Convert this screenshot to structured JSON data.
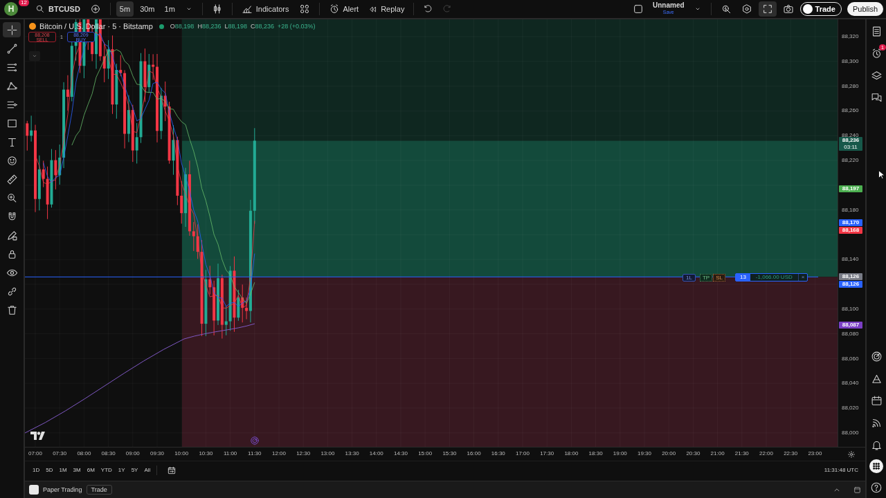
{
  "top_bar": {
    "avatar": {
      "letter": "H",
      "badge": "12"
    },
    "symbol": "BTCUSD",
    "intervals": [
      {
        "label": "5m",
        "selected": true
      },
      {
        "label": "30m",
        "selected": false
      },
      {
        "label": "1m",
        "selected": false
      }
    ],
    "indicators_label": "Indicators",
    "alert_label": "Alert",
    "replay_label": "Replay",
    "undo": {
      "disabled": false
    },
    "redo": {
      "disabled": true
    },
    "layout": {
      "name": "Unnamed",
      "status": "Save"
    },
    "trade_button": "Trade",
    "publish_button": "Publish"
  },
  "left_toolbar": {
    "tools": [
      {
        "kind": "crosshair",
        "selected": true
      },
      {
        "kind": "trendline",
        "selected": false
      },
      {
        "kind": "fib",
        "selected": false
      },
      {
        "kind": "pattern",
        "selected": false
      },
      {
        "kind": "forecast",
        "selected": false
      },
      {
        "kind": "shapes",
        "selected": false
      },
      {
        "kind": "text",
        "selected": false
      },
      {
        "kind": "smiley",
        "selected": false
      },
      {
        "kind": "ruler",
        "selected": false
      },
      {
        "kind": "zoom",
        "selected": false
      },
      {
        "kind": "magnet",
        "selected": false
      },
      {
        "kind": "pencil",
        "selected": false
      },
      {
        "kind": "lock",
        "selected": false
      },
      {
        "kind": "eye",
        "selected": false
      },
      {
        "kind": "link",
        "selected": false
      },
      {
        "kind": "trash",
        "selected": false
      }
    ]
  },
  "chart": {
    "legend": {
      "title": "Bitcoin / U.S. Dollar · 5 · Bitstamp",
      "ohlc": [
        {
          "label": "O",
          "value": "88,198"
        },
        {
          "label": "H",
          "value": "88,236"
        },
        {
          "label": "L",
          "value": "88,198"
        },
        {
          "label": "C",
          "value": "88,236"
        }
      ],
      "change": "+28 (+0.03%)"
    },
    "sell": {
      "price": "88,208",
      "label": "SELL"
    },
    "quantity": "1",
    "buy": {
      "price": "88,209",
      "label": "BUY"
    },
    "position": {
      "quantity": "1L",
      "tp": "TP",
      "sl": "SL",
      "count": "13",
      "pnl": "-1,066.00 USD",
      "close": "×"
    },
    "price_axis": {
      "ticks": [
        "88,320",
        "88,300",
        "88,280",
        "88,260",
        "88,240",
        "88,220",
        "88,180",
        "88,140",
        "88,100",
        "88,080",
        "88,060",
        "88,040",
        "88,020",
        "88,000"
      ],
      "tags": [
        {
          "text": "88,236",
          "subtext": "03:11",
          "color": "#17584a"
        },
        {
          "text": "88,197",
          "color": "#4caf50"
        },
        {
          "text": "88,170",
          "color": "#2962ff"
        },
        {
          "text": "88,168",
          "color": "#f23645"
        },
        {
          "text": "88,126",
          "color": "#787b86"
        },
        {
          "text": "88,126",
          "color": "#2962ff"
        },
        {
          "text": "88,087",
          "color": "#7b3fc4"
        }
      ]
    },
    "time_axis": {
      "ticks": [
        "07:00",
        "07:30",
        "08:00",
        "08:30",
        "09:00",
        "09:30",
        "10:00",
        "10:30",
        "11:00",
        "11:30",
        "12:00",
        "12:30",
        "13:00",
        "13:30",
        "14:00",
        "14:30",
        "15:00",
        "15:30",
        "16:00",
        "16:30",
        "17:00",
        "17:30",
        "18:00",
        "18:30",
        "19:00",
        "19:30",
        "20:00",
        "20:30",
        "21:00",
        "21:30",
        "22:00",
        "22:30",
        "23:00"
      ]
    },
    "ranges": [
      "1D",
      "5D",
      "1M",
      "3M",
      "6M",
      "YTD",
      "1Y",
      "5Y",
      "All"
    ],
    "clock": "11:31:48 UTC"
  },
  "right_sidebar": {
    "alerts_badge": "1"
  },
  "bottom_bar": {
    "title": "Paper Trading",
    "trade_button": "Trade"
  }
}
